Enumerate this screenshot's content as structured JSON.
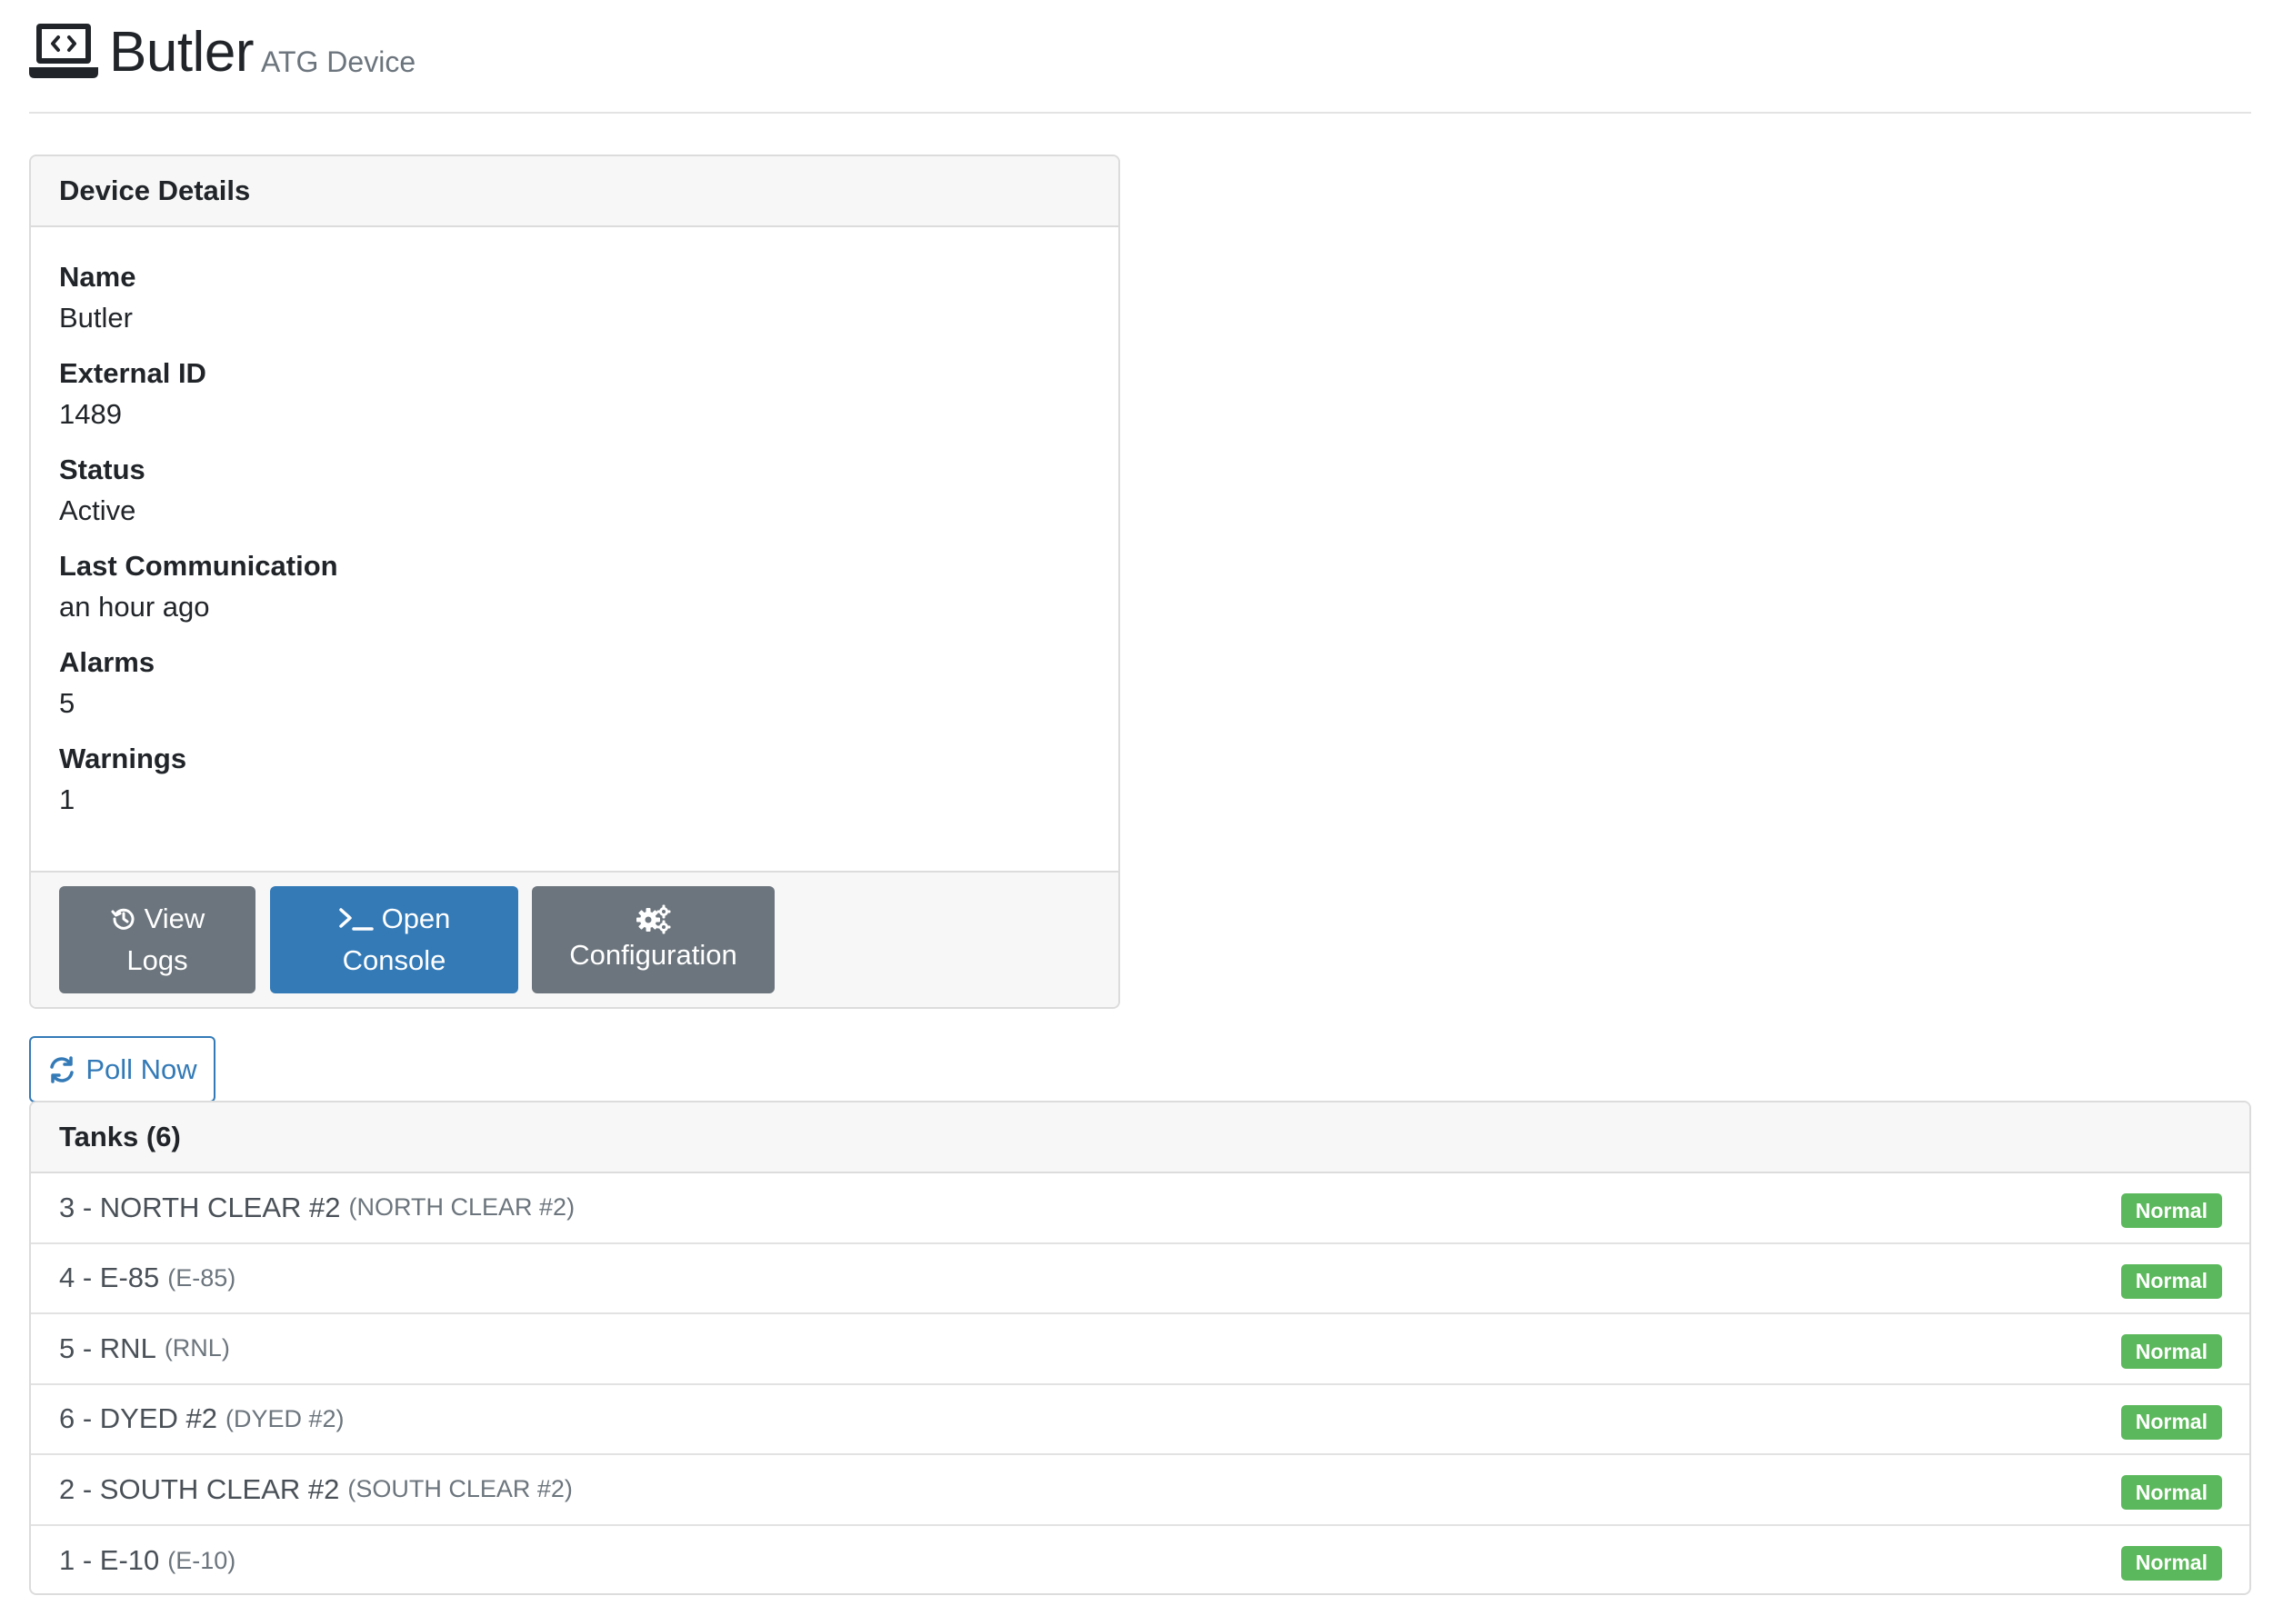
{
  "header": {
    "title": "Butler",
    "subtitle": "ATG Device"
  },
  "details": {
    "card_title": "Device Details",
    "fields": [
      {
        "label": "Name",
        "value": "Butler"
      },
      {
        "label": "External ID",
        "value": "1489"
      },
      {
        "label": "Status",
        "value": "Active"
      },
      {
        "label": "Last Communication",
        "value": "an hour ago"
      },
      {
        "label": "Alarms",
        "value": "5"
      },
      {
        "label": "Warnings",
        "value": "1"
      }
    ],
    "buttons": {
      "view_logs_line1": "View",
      "view_logs_line2": "Logs",
      "open_console_line1": "Open",
      "open_console_line2": "Console",
      "configuration": "Configuration"
    }
  },
  "poll": {
    "label": "Poll Now"
  },
  "tanks": {
    "title": "Tanks (6)",
    "rows": [
      {
        "name": "3 - NORTH CLEAR #2",
        "product": "(NORTH CLEAR #2)",
        "status": "Normal"
      },
      {
        "name": "4 - E-85",
        "product": "(E-85)",
        "status": "Normal"
      },
      {
        "name": "5 - RNL",
        "product": "(RNL)",
        "status": "Normal"
      },
      {
        "name": "6 - DYED #2",
        "product": "(DYED #2)",
        "status": "Normal"
      },
      {
        "name": "2 - SOUTH CLEAR #2",
        "product": "(SOUTH CLEAR #2)",
        "status": "Normal"
      },
      {
        "name": "1 - E-10",
        "product": "(E-10)",
        "status": "Normal"
      }
    ]
  },
  "colors": {
    "primary": "#337ab7",
    "secondary": "#6c757d",
    "success": "#5cb85c"
  },
  "icons": {
    "device": "laptop-code-icon",
    "logs": "history-icon",
    "console": "terminal-icon",
    "configuration": "cogs-icon",
    "poll": "sync-icon"
  }
}
